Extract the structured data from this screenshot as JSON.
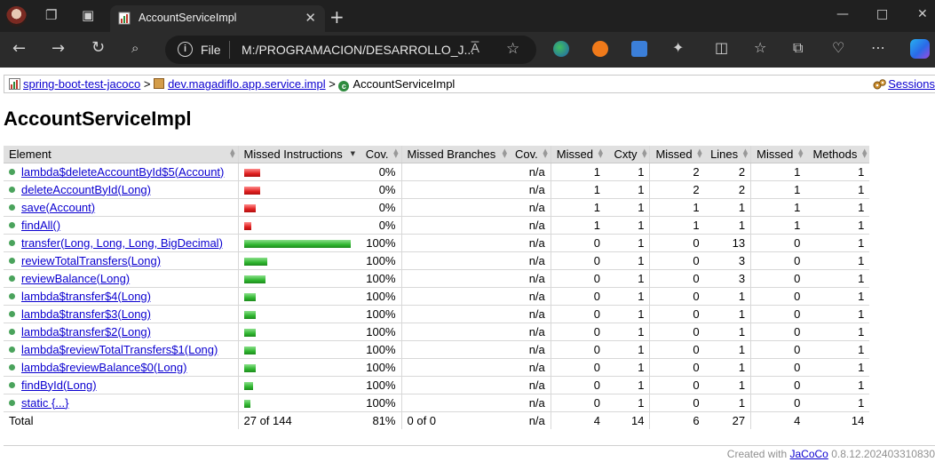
{
  "browser": {
    "tab_title": "AccountServiceImpl",
    "address_scheme": "File",
    "address_url": "M:/PROGRAMACION/DESARROLLO_J...",
    "reader_label": "A",
    "read_aloud": "A̅"
  },
  "breadcrumb": {
    "report": "spring-boot-test-jacoco",
    "package": "dev.magadiflo.app.service.impl",
    "class": "AccountServiceImpl",
    "sep": ">",
    "sessions": "Sessions"
  },
  "page_title": "AccountServiceImpl",
  "table": {
    "headers": [
      "Element",
      "Missed Instructions",
      "Cov.",
      "Missed Branches",
      "Cov.",
      "Missed",
      "Cxty",
      "Missed",
      "Lines",
      "Missed",
      "Methods"
    ],
    "rows": [
      {
        "name": "lambda$deleteAccountById$5(Account)",
        "missed_pct": 100,
        "covered_pct": 0,
        "bar_fraction": 0.15,
        "cov": "0%",
        "branches": "",
        "bcov": "n/a",
        "mcx": "1",
        "cx": "1",
        "ml": "2",
        "l": "2",
        "mm": "1",
        "m": "1"
      },
      {
        "name": "deleteAccountById(Long)",
        "missed_pct": 100,
        "covered_pct": 0,
        "bar_fraction": 0.15,
        "cov": "0%",
        "branches": "",
        "bcov": "n/a",
        "mcx": "1",
        "cx": "1",
        "ml": "2",
        "l": "2",
        "mm": "1",
        "m": "1"
      },
      {
        "name": "save(Account)",
        "missed_pct": 100,
        "covered_pct": 0,
        "bar_fraction": 0.11,
        "cov": "0%",
        "branches": "",
        "bcov": "n/a",
        "mcx": "1",
        "cx": "1",
        "ml": "1",
        "l": "1",
        "mm": "1",
        "m": "1"
      },
      {
        "name": "findAll()",
        "missed_pct": 100,
        "covered_pct": 0,
        "bar_fraction": 0.07,
        "cov": "0%",
        "branches": "",
        "bcov": "n/a",
        "mcx": "1",
        "cx": "1",
        "ml": "1",
        "l": "1",
        "mm": "1",
        "m": "1"
      },
      {
        "name": "transfer(Long, Long, Long, BigDecimal)",
        "missed_pct": 0,
        "covered_pct": 100,
        "bar_fraction": 1.0,
        "cov": "100%",
        "branches": "",
        "bcov": "n/a",
        "mcx": "0",
        "cx": "1",
        "ml": "0",
        "l": "13",
        "mm": "0",
        "m": "1"
      },
      {
        "name": "reviewTotalTransfers(Long)",
        "missed_pct": 0,
        "covered_pct": 100,
        "bar_fraction": 0.22,
        "cov": "100%",
        "branches": "",
        "bcov": "n/a",
        "mcx": "0",
        "cx": "1",
        "ml": "0",
        "l": "3",
        "mm": "0",
        "m": "1"
      },
      {
        "name": "reviewBalance(Long)",
        "missed_pct": 0,
        "covered_pct": 100,
        "bar_fraction": 0.2,
        "cov": "100%",
        "branches": "",
        "bcov": "n/a",
        "mcx": "0",
        "cx": "1",
        "ml": "0",
        "l": "3",
        "mm": "0",
        "m": "1"
      },
      {
        "name": "lambda$transfer$4(Long)",
        "missed_pct": 0,
        "covered_pct": 100,
        "bar_fraction": 0.11,
        "cov": "100%",
        "branches": "",
        "bcov": "n/a",
        "mcx": "0",
        "cx": "1",
        "ml": "0",
        "l": "1",
        "mm": "0",
        "m": "1"
      },
      {
        "name": "lambda$transfer$3(Long)",
        "missed_pct": 0,
        "covered_pct": 100,
        "bar_fraction": 0.11,
        "cov": "100%",
        "branches": "",
        "bcov": "n/a",
        "mcx": "0",
        "cx": "1",
        "ml": "0",
        "l": "1",
        "mm": "0",
        "m": "1"
      },
      {
        "name": "lambda$transfer$2(Long)",
        "missed_pct": 0,
        "covered_pct": 100,
        "bar_fraction": 0.11,
        "cov": "100%",
        "branches": "",
        "bcov": "n/a",
        "mcx": "0",
        "cx": "1",
        "ml": "0",
        "l": "1",
        "mm": "0",
        "m": "1"
      },
      {
        "name": "lambda$reviewTotalTransfers$1(Long)",
        "missed_pct": 0,
        "covered_pct": 100,
        "bar_fraction": 0.11,
        "cov": "100%",
        "branches": "",
        "bcov": "n/a",
        "mcx": "0",
        "cx": "1",
        "ml": "0",
        "l": "1",
        "mm": "0",
        "m": "1"
      },
      {
        "name": "lambda$reviewBalance$0(Long)",
        "missed_pct": 0,
        "covered_pct": 100,
        "bar_fraction": 0.11,
        "cov": "100%",
        "branches": "",
        "bcov": "n/a",
        "mcx": "0",
        "cx": "1",
        "ml": "0",
        "l": "1",
        "mm": "0",
        "m": "1"
      },
      {
        "name": "findById(Long)",
        "missed_pct": 0,
        "covered_pct": 100,
        "bar_fraction": 0.08,
        "cov": "100%",
        "branches": "",
        "bcov": "n/a",
        "mcx": "0",
        "cx": "1",
        "ml": "0",
        "l": "1",
        "mm": "0",
        "m": "1"
      },
      {
        "name": "static {...}",
        "missed_pct": 0,
        "covered_pct": 100,
        "bar_fraction": 0.06,
        "cov": "100%",
        "branches": "",
        "bcov": "n/a",
        "mcx": "0",
        "cx": "1",
        "ml": "0",
        "l": "1",
        "mm": "0",
        "m": "1"
      }
    ],
    "total": {
      "label": "Total",
      "instr": "27 of 144",
      "cov": "81%",
      "branches": "0 of 0",
      "bcov": "n/a",
      "mcx": "4",
      "cx": "14",
      "ml": "6",
      "l": "27",
      "mm": "4",
      "m": "14"
    }
  },
  "footer": {
    "prefix": "Created with",
    "link": "JaCoCo",
    "version": "0.8.12.202403310830"
  },
  "colors": {
    "missed": "#e02020",
    "covered": "#2fb52f",
    "link": "#0b00d0"
  }
}
